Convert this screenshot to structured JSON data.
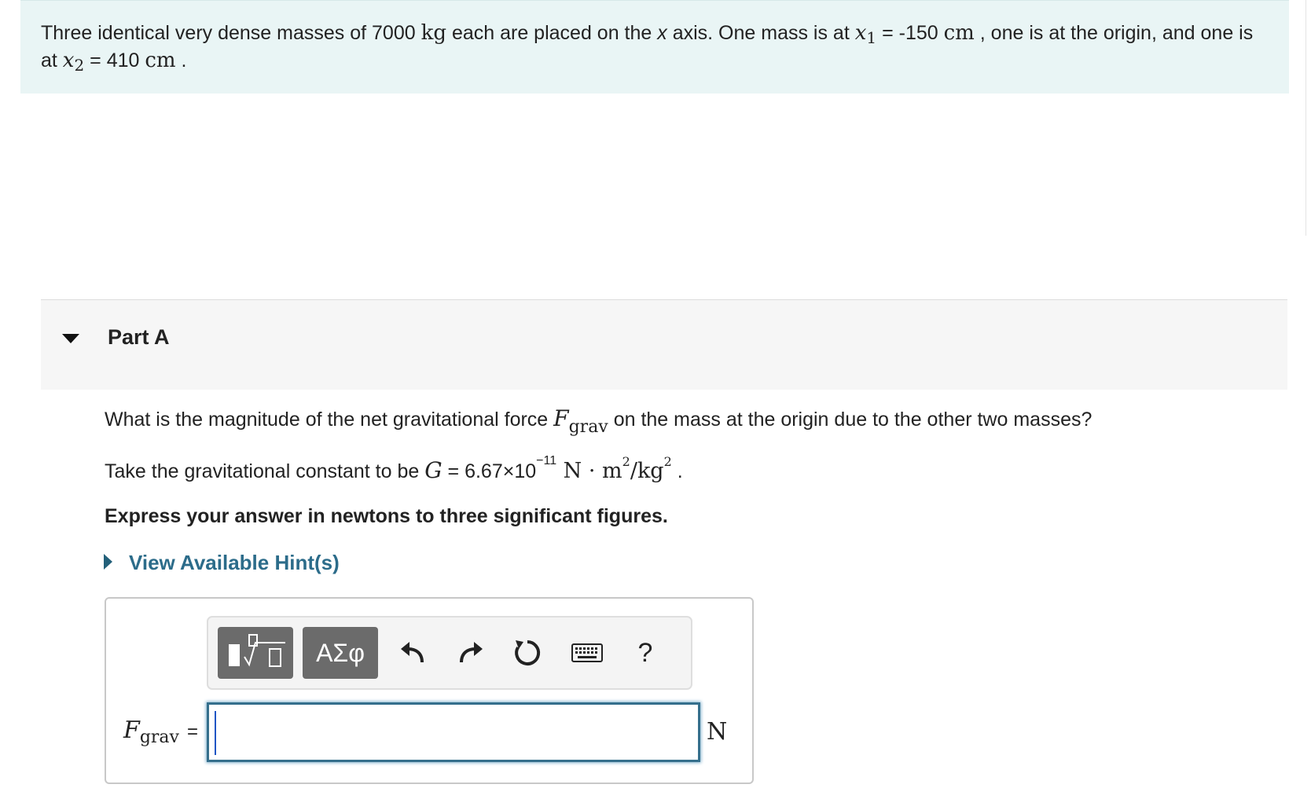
{
  "intro": {
    "t1": "Three identical very dense masses of 7000 ",
    "kg": "kg",
    "t2": " each are placed on the ",
    "xaxis": "x",
    "t3": " axis. One mass is at ",
    "x1": "x",
    "x1sub": "1",
    "t4": " = -150 ",
    "cm1": "cm",
    "t5": " , one is at the origin, and one is at ",
    "x2": "x",
    "x2sub": "2",
    "t6": " = 410 ",
    "cm2": "cm",
    "t7": " ."
  },
  "part": {
    "title": "Part A"
  },
  "question": {
    "q1a": "What is the magnitude of the net gravitational force ",
    "F": "F",
    "Fsub": "grav",
    "q1b": " on the mass at the origin due to the other two masses?",
    "q2a": "Take the gravitational constant to be ",
    "G": "G",
    "q2b": " = 6.67×10",
    "exp": "−11",
    "unitN": " N · m",
    "sq1": "2",
    "unitKg": "/kg",
    "sq2": "2",
    "q2c": " .",
    "q3": "Express your answer in newtons to three significant figures."
  },
  "hint": {
    "label": "View Available Hint(s)"
  },
  "toolbar": {
    "symbols_label": "ΑΣφ",
    "help_label": "?",
    "icons": [
      "templates-icon",
      "undo-icon",
      "redo-icon",
      "reset-icon",
      "keyboard-icon",
      "help-icon"
    ]
  },
  "answer": {
    "lhs_var": "F",
    "lhs_sub": "grav",
    "lhs_eq": "=",
    "value": "",
    "unit": "N"
  },
  "colors": {
    "intro_bg": "#e9f5f5",
    "hint_link": "#2c6c8a",
    "input_border": "#356f8c"
  }
}
